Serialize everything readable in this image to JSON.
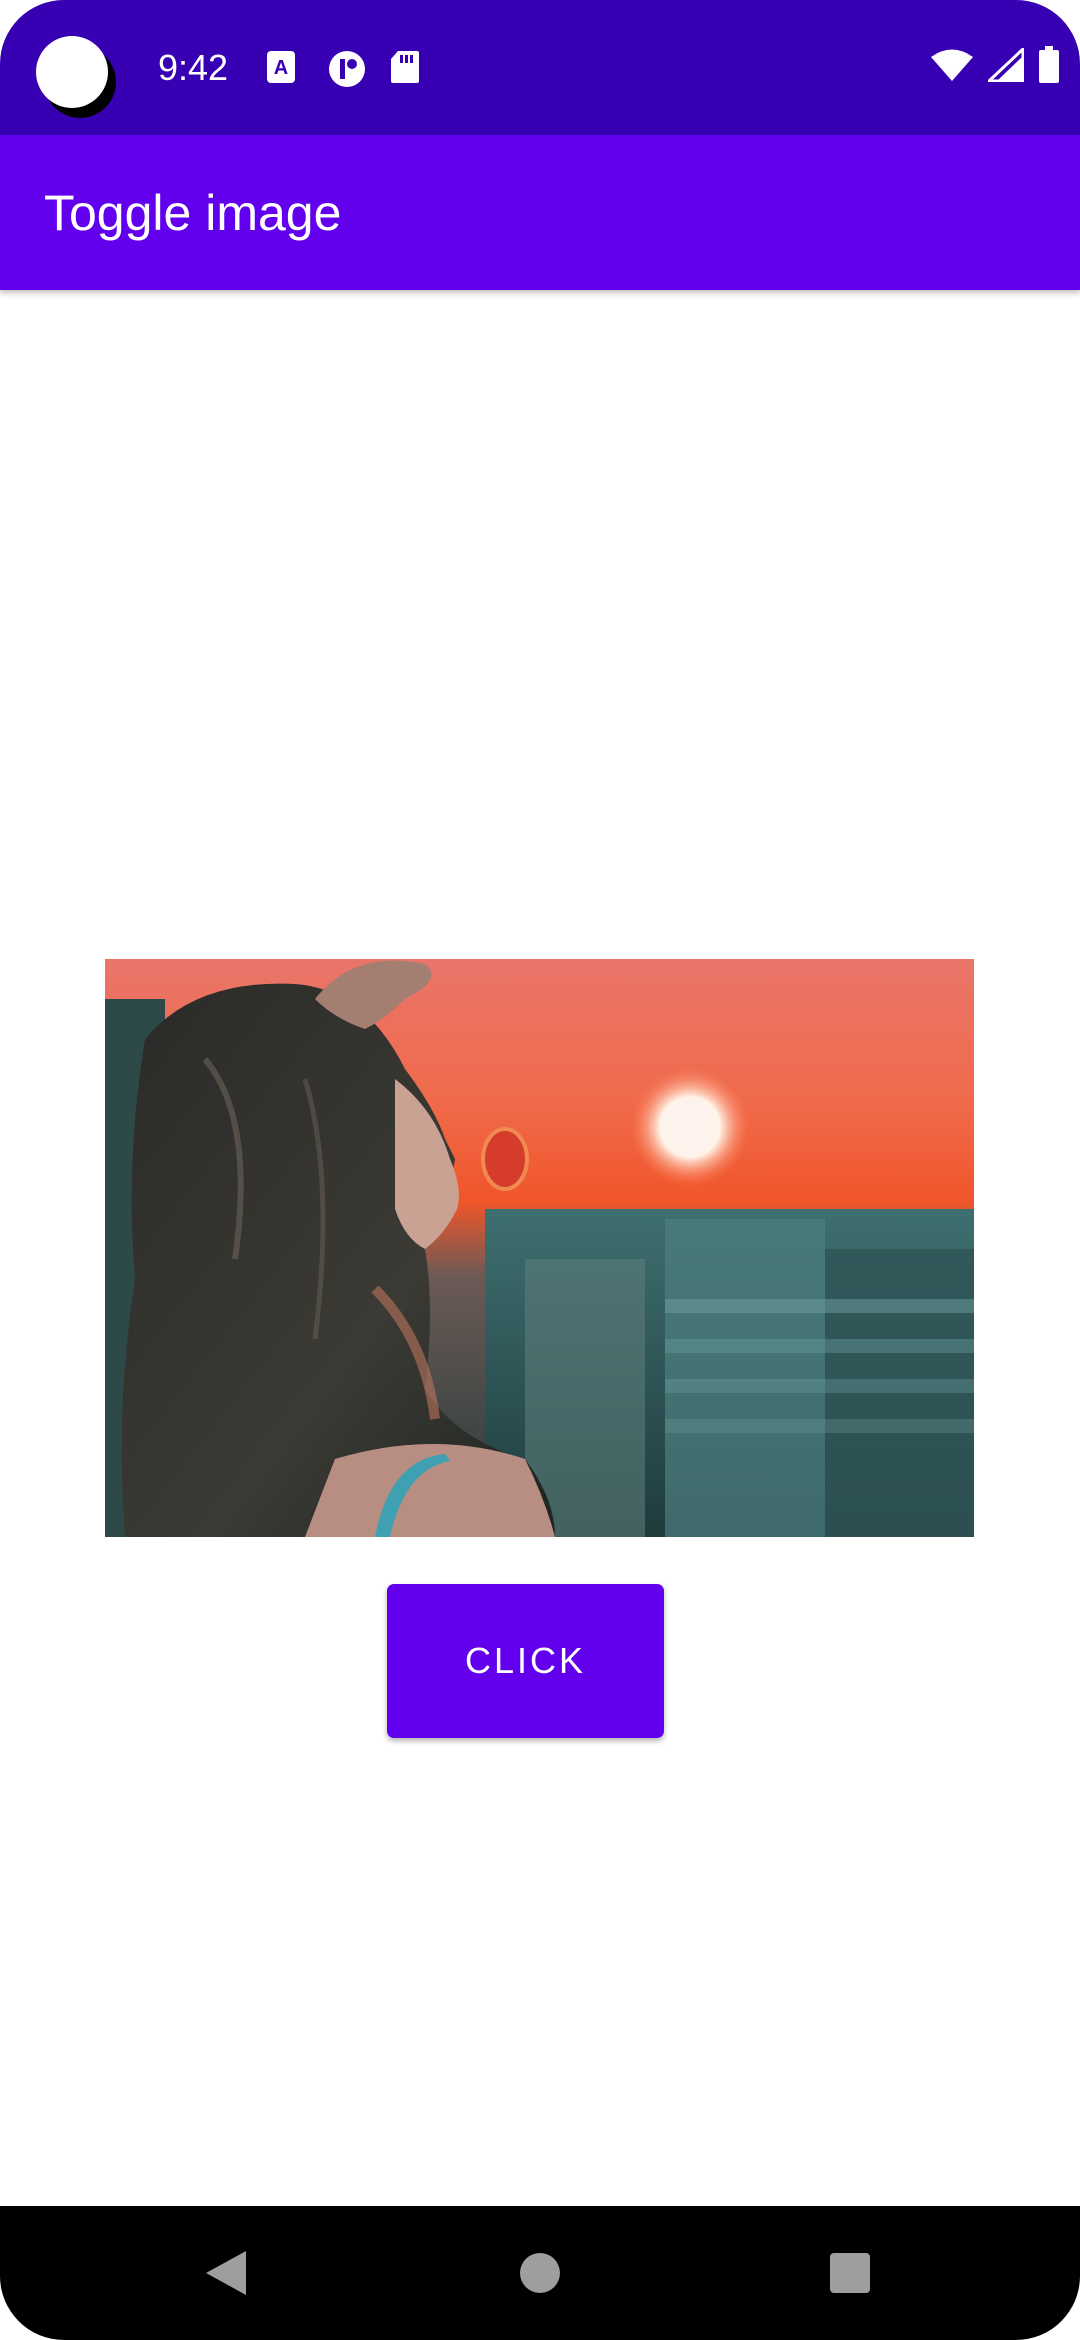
{
  "status_bar": {
    "time": "9:42",
    "notification_icons": [
      "a11y-text-icon",
      "circle-app-icon",
      "sd-card-icon"
    ],
    "system_icons": [
      "wifi-icon",
      "cell-signal-icon",
      "battery-icon"
    ]
  },
  "app_bar": {
    "title": "Toggle image"
  },
  "main": {
    "image": {
      "description_icon": "photo-woman-sunset"
    },
    "button": {
      "label": "CLICK"
    }
  },
  "nav_bar": {
    "buttons": [
      "back-icon",
      "home-icon",
      "recents-icon"
    ]
  },
  "colors": {
    "status_bar": "#3700B3",
    "primary": "#6200EE",
    "background": "#FFFFFF",
    "nav_bar": "#000000"
  }
}
